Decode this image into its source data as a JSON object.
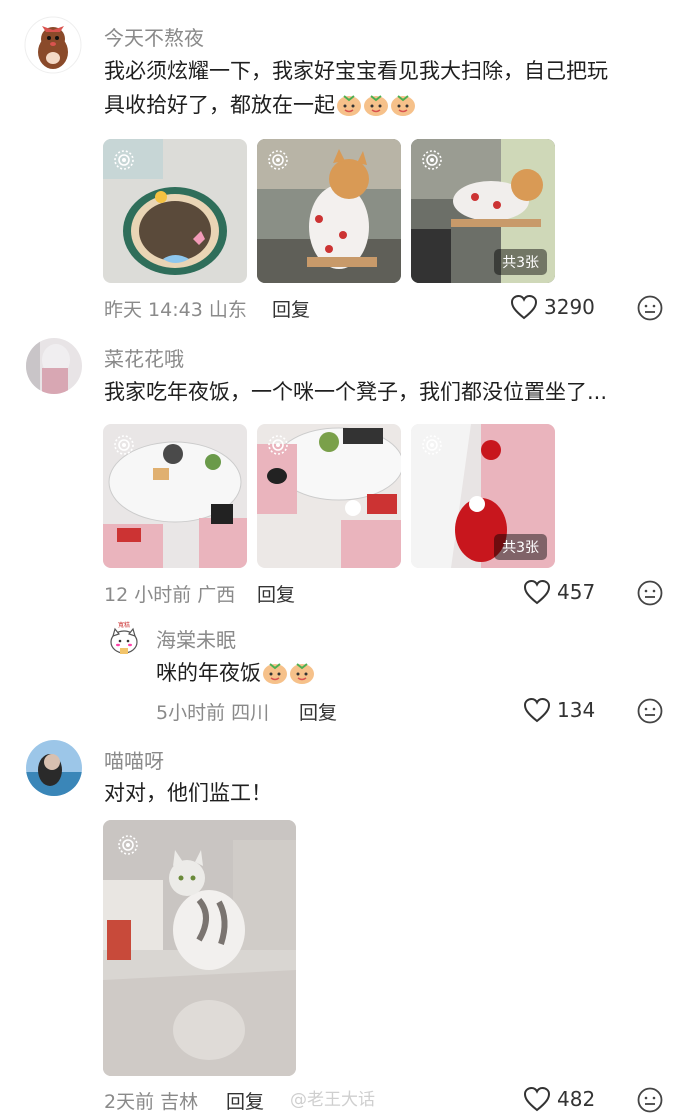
{
  "comments": [
    {
      "user": "今天不熬夜",
      "text_line1": "我必须炫耀一下，我家好宝宝看见我大扫除，自己把玩",
      "text_line2": "具收拾好了，都放在一起",
      "time": "昨天 14:43",
      "location": "山东",
      "reply_label": "回复",
      "likes": "3290",
      "image_count": "共3张"
    },
    {
      "user": "菜花花哦",
      "text": "我家吃年夜饭，一个咪一个凳子，我们都没位置坐了...",
      "time": "12 小时前",
      "location": "广西",
      "reply_label": "回复",
      "likes": "457",
      "image_count": "共3张"
    },
    {
      "user": "海棠未眠",
      "text": "咪的年夜饭",
      "time": "5小时前",
      "location": "四川",
      "reply_label": "回复",
      "likes": "134",
      "avatar_text": "寬糕"
    },
    {
      "user": "喵喵呀",
      "text": "对对，他们监工！",
      "time": "2天前",
      "location": "吉林",
      "reply_label": "回复",
      "likes": "482"
    }
  ],
  "watermark": "@老王大话",
  "icons": {
    "like": "heart-outline-icon",
    "more": "more-options-icon",
    "live": "live-photo-icon",
    "emoji": "fruit-face-emoji"
  },
  "colors": {
    "meta_text": "#8a8a8a",
    "main_text": "#1f1f1f",
    "background": "#ffffff"
  }
}
